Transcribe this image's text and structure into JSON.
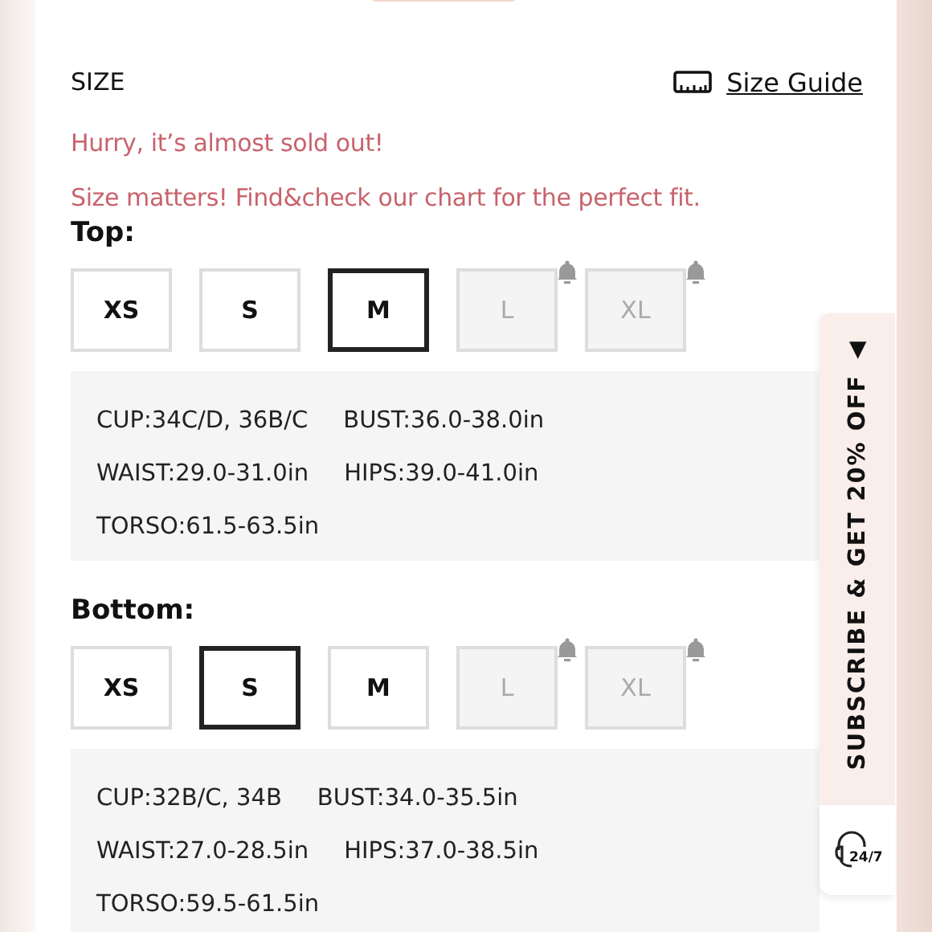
{
  "size_section": {
    "heading": "SIZE",
    "size_guide": "Size Guide",
    "notices": [
      "Hurry, it’s almost sold out!",
      "Size matters! Find&check our chart for the perfect fit."
    ],
    "groups": [
      {
        "label": "Top:",
        "sizes": [
          {
            "label": "XS",
            "selected": false,
            "available": true
          },
          {
            "label": "S",
            "selected": false,
            "available": true
          },
          {
            "label": "M",
            "selected": true,
            "available": true
          },
          {
            "label": "L",
            "selected": false,
            "available": false
          },
          {
            "label": "XL",
            "selected": false,
            "available": false
          }
        ],
        "specs": [
          [
            "CUP:34C/D, 36B/C",
            "BUST:36.0-38.0in"
          ],
          [
            "WAIST:29.0-31.0in",
            "HIPS:39.0-41.0in"
          ],
          [
            "TORSO:61.5-63.5in"
          ]
        ]
      },
      {
        "label": "Bottom:",
        "sizes": [
          {
            "label": "XS",
            "selected": false,
            "available": true
          },
          {
            "label": "S",
            "selected": true,
            "available": true
          },
          {
            "label": "M",
            "selected": false,
            "available": true
          },
          {
            "label": "L",
            "selected": false,
            "available": false
          },
          {
            "label": "XL",
            "selected": false,
            "available": false
          }
        ],
        "specs": [
          [
            "CUP:32B/C, 34B",
            "BUST:34.0-35.5in"
          ],
          [
            "WAIST:27.0-28.5in",
            "HIPS:37.0-38.5in"
          ],
          [
            "TORSO:59.5-61.5in"
          ]
        ]
      }
    ]
  },
  "side_tab": {
    "label": "SUBSCRIBE & GET 20% OFF",
    "arrow": "◀",
    "support": "24/7"
  }
}
